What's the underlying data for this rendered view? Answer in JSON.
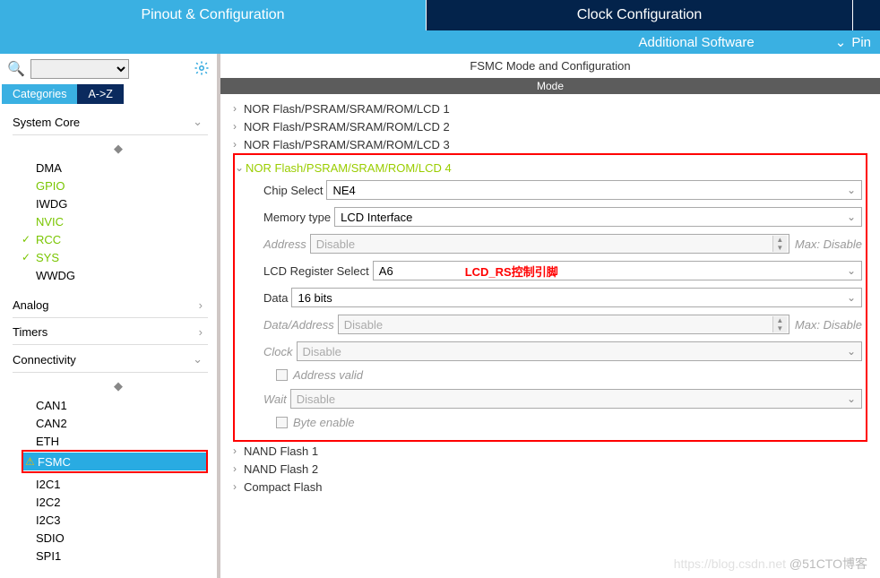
{
  "tabs": {
    "pinout": "Pinout & Configuration",
    "clock": "Clock Configuration"
  },
  "subbar": {
    "additional": "Additional Software",
    "pin": "Pin"
  },
  "cats": {
    "categories": "Categories",
    "az": "A->Z"
  },
  "sections": {
    "sysCore": "System Core",
    "analog": "Analog",
    "timers": "Timers",
    "connectivity": "Connectivity"
  },
  "sysItems": [
    "DMA",
    "GPIO",
    "IWDG",
    "NVIC",
    "RCC",
    "SYS",
    "WWDG"
  ],
  "connItems": [
    "CAN1",
    "CAN2",
    "ETH",
    "FSMC",
    "I2C1",
    "I2C2",
    "I2C3",
    "SDIO",
    "SPI1"
  ],
  "right": {
    "title": "FSMC Mode and Configuration",
    "modeHdr": "Mode",
    "groups": [
      "NOR Flash/PSRAM/SRAM/ROM/LCD 1",
      "NOR Flash/PSRAM/SRAM/ROM/LCD 2",
      "NOR Flash/PSRAM/SRAM/ROM/LCD 3",
      "NOR Flash/PSRAM/SRAM/ROM/LCD 4",
      "NAND Flash 1",
      "NAND Flash 2",
      "Compact Flash"
    ],
    "fields": {
      "chipSelect": {
        "label": "Chip Select",
        "value": "NE4"
      },
      "memoryType": {
        "label": "Memory type",
        "value": "LCD Interface"
      },
      "address": {
        "label": "Address",
        "value": "Disable",
        "max": "Max: Disable"
      },
      "lcdRegSel": {
        "label": "LCD Register Select",
        "value": "A6"
      },
      "lcdAnno": "LCD_RS控制引脚",
      "data": {
        "label": "Data",
        "value": "16 bits"
      },
      "dataAddr": {
        "label": "Data/Address",
        "value": "Disable",
        "max": "Max: Disable"
      },
      "clock": {
        "label": "Clock",
        "value": "Disable"
      },
      "addrValid": "Address valid",
      "wait": {
        "label": "Wait",
        "value": "Disable"
      },
      "byteEnable": "Byte enable"
    }
  },
  "watermark": {
    "blog": "https://blog.csdn.net",
    "at": "@51CTO博客"
  }
}
